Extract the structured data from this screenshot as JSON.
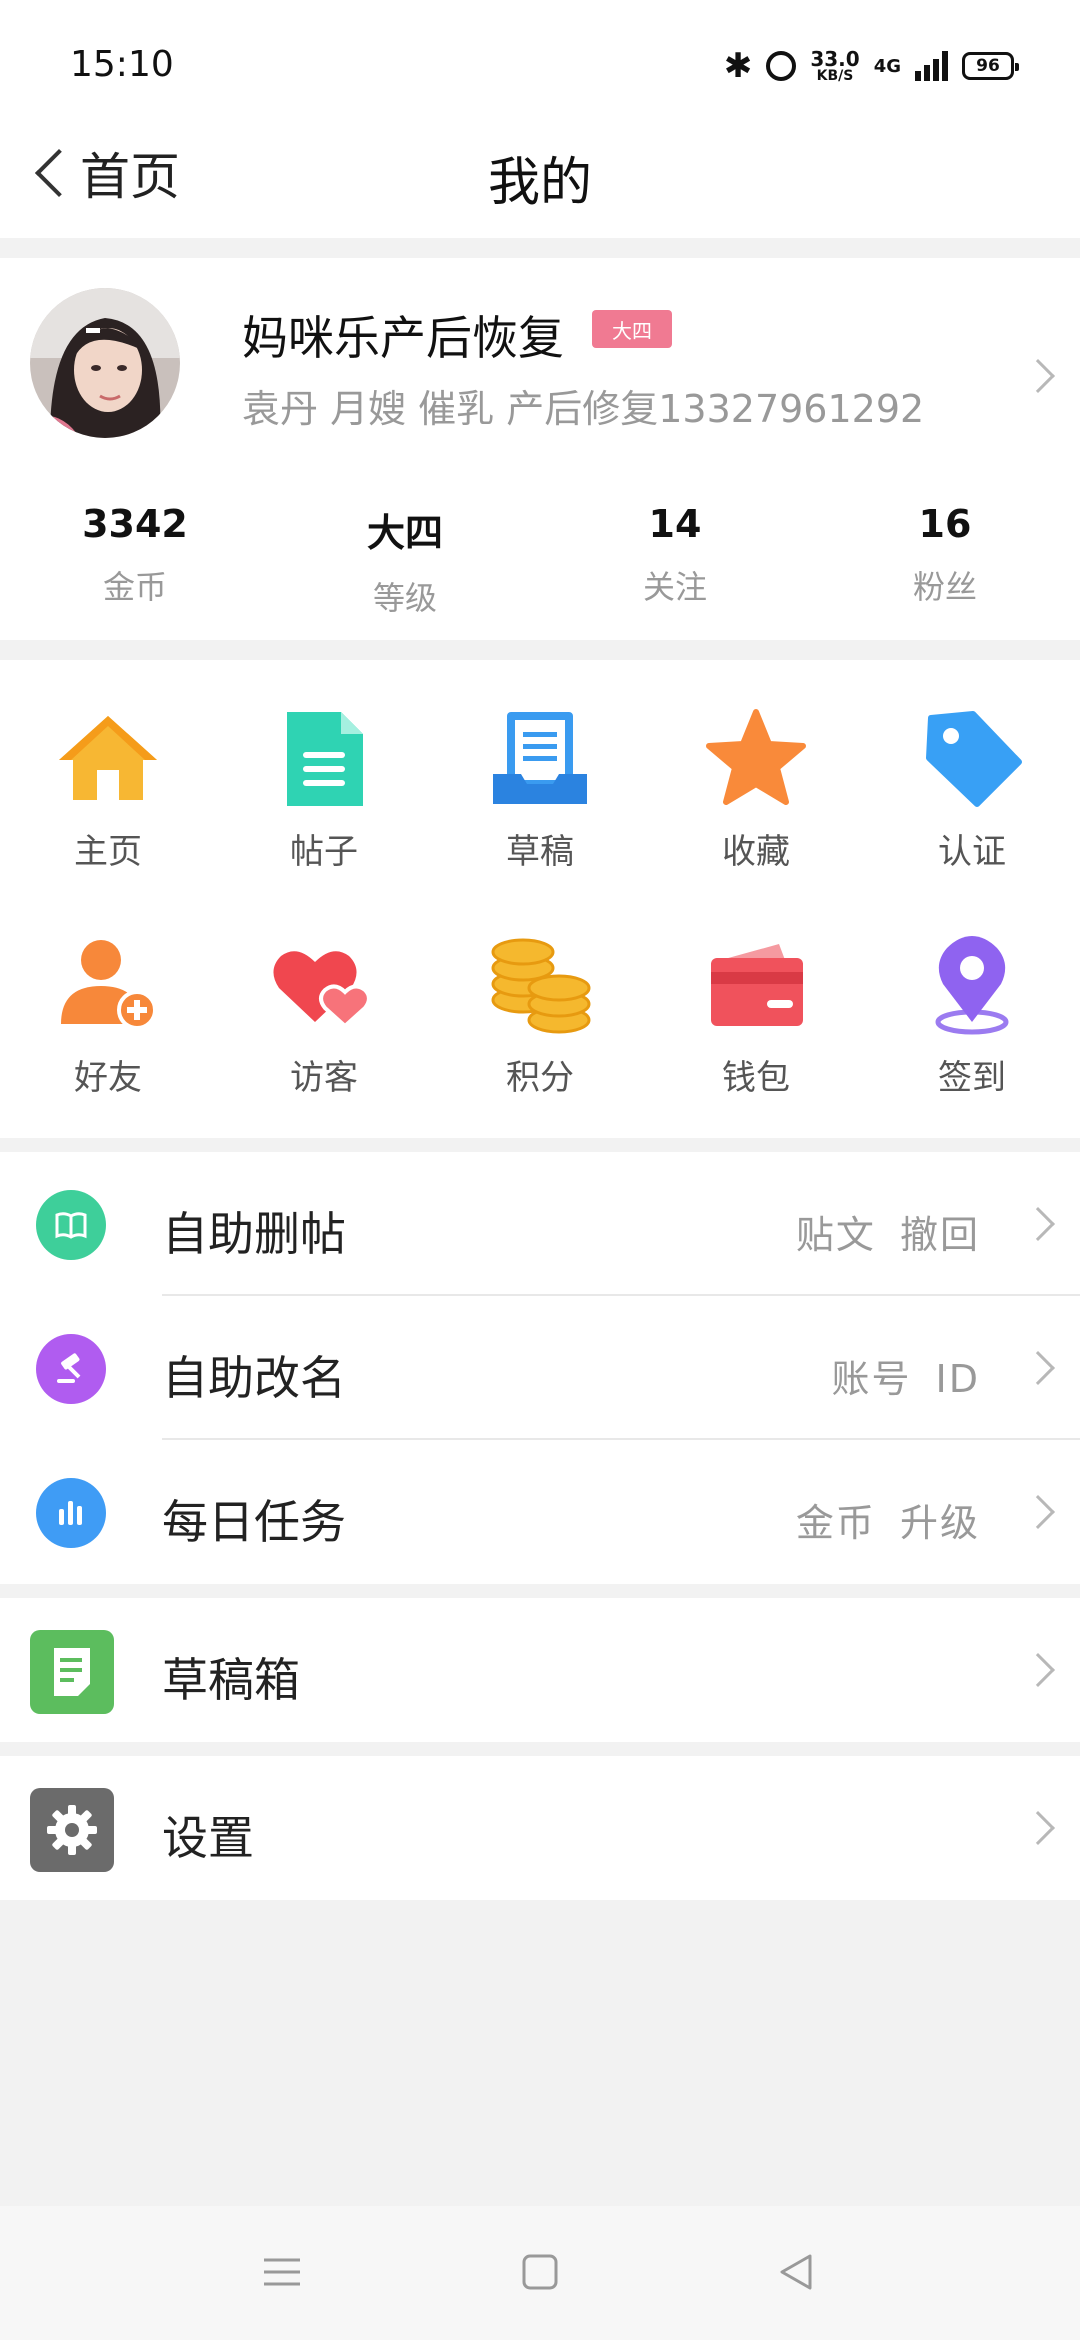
{
  "status_bar": {
    "time": "15:10",
    "speed_value": "33.0",
    "speed_unit": "KB/S",
    "network": "4G",
    "battery": "96"
  },
  "nav": {
    "back_label": "首页",
    "title": "我的"
  },
  "profile": {
    "name": "妈咪乐产后恢复",
    "badge": "大四",
    "description": "袁丹 月嫂 催乳 产后修复13327961292",
    "stats": [
      {
        "value": "3342",
        "label": "金币"
      },
      {
        "value": "大四",
        "label": "等级"
      },
      {
        "value": "14",
        "label": "关注"
      },
      {
        "value": "16",
        "label": "粉丝"
      }
    ]
  },
  "grid": {
    "row1": [
      {
        "label": "主页",
        "icon": "home-icon"
      },
      {
        "label": "帖子",
        "icon": "post-icon"
      },
      {
        "label": "草稿",
        "icon": "draft-icon"
      },
      {
        "label": "收藏",
        "icon": "star-icon"
      },
      {
        "label": "认证",
        "icon": "tag-icon"
      }
    ],
    "row2": [
      {
        "label": "好友",
        "icon": "add-friend-icon"
      },
      {
        "label": "访客",
        "icon": "hearts-icon"
      },
      {
        "label": "积分",
        "icon": "coins-icon"
      },
      {
        "label": "钱包",
        "icon": "wallet-icon"
      },
      {
        "label": "签到",
        "icon": "location-pin-icon"
      }
    ]
  },
  "list": [
    {
      "label": "自助删帖",
      "right": "贴文 撤回",
      "icon": "book-icon",
      "color": "#3ecf9a"
    },
    {
      "label": "自助改名",
      "right": "账号 ID",
      "icon": "gavel-icon",
      "color": "#b05cf0"
    },
    {
      "label": "每日任务",
      "right": "金币 升级",
      "icon": "bar-chart-icon",
      "color": "#3f9cf5"
    }
  ],
  "drafts": {
    "label": "草稿箱",
    "icon": "document-icon",
    "color": "#5cbd5e"
  },
  "settings": {
    "label": "设置",
    "icon": "gear-icon",
    "color": "#6b6b6b"
  }
}
